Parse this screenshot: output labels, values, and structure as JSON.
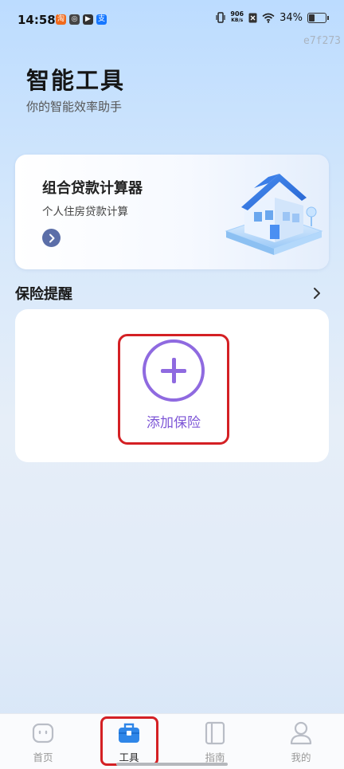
{
  "status_bar": {
    "time": "14:58",
    "net_speed_value": "906",
    "net_speed_unit": "KB/s",
    "battery": "34%",
    "battery_level": 0.34,
    "app_icons": [
      "taobao-icon",
      "app-icon",
      "video-icon",
      "alipay-icon"
    ]
  },
  "watermark": "e7f273",
  "header": {
    "title": "智能工具",
    "subtitle": "你的智能效率助手"
  },
  "loan_card": {
    "title": "组合贷款计算器",
    "subtitle": "个人住房贷款计算"
  },
  "insurance": {
    "section_title": "保险提醒",
    "add_label": "添加保险"
  },
  "nav": {
    "items": [
      {
        "label": "首页",
        "icon": "home-icon"
      },
      {
        "label": "工具",
        "icon": "toolbox-icon"
      },
      {
        "label": "指南",
        "icon": "book-icon"
      },
      {
        "label": "我的",
        "icon": "profile-icon"
      }
    ],
    "active": "工具"
  },
  "colors": {
    "accent_purple": "#8f6ae0",
    "nav_active_blue": "#2f86e8",
    "highlight_red": "#d42024"
  }
}
